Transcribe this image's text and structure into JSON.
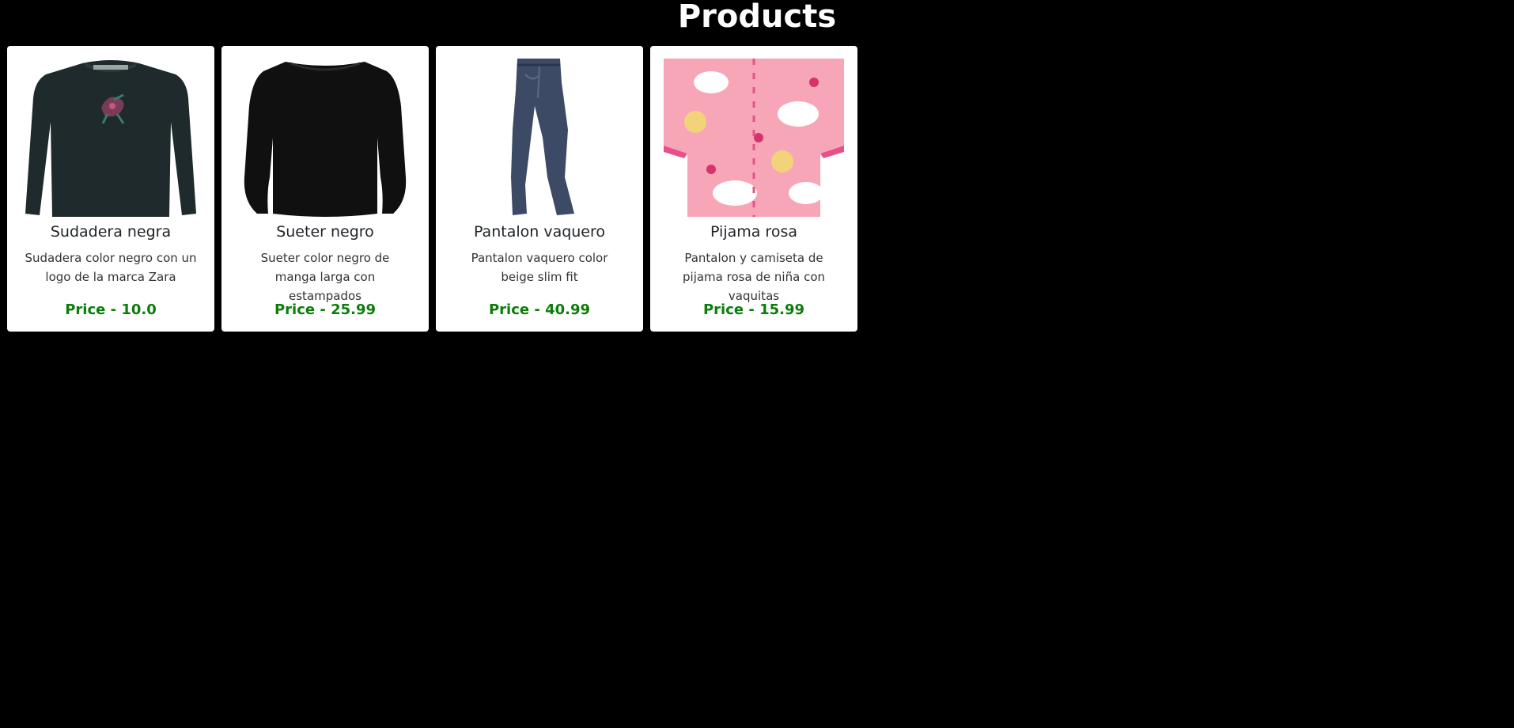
{
  "header": {
    "title": "Products"
  },
  "products": [
    {
      "name": "Sudadera negra",
      "description": "Sudadera color negro con un logo de la marca Zara",
      "price_label": "Price - 10.0",
      "image_icon": "sweatshirt-icon"
    },
    {
      "name": "Sueter negro",
      "description": "Sueter color negro de manga larga con estampados",
      "price_label": "Price - 25.99",
      "image_icon": "sweater-icon"
    },
    {
      "name": "Pantalon vaquero",
      "description": "Pantalon vaquero color beige slim fit",
      "price_label": "Price - 40.99",
      "image_icon": "jeans-icon"
    },
    {
      "name": "Pijama rosa",
      "description": "Pantalon y camiseta de pijama rosa de niña con vaquitas",
      "price_label": "Price - 15.99",
      "image_icon": "pajama-icon"
    }
  ],
  "colors": {
    "background": "#000000",
    "card": "#ffffff",
    "price": "#0a7d0a",
    "sweatshirt": "#1e2a2c",
    "sweater": "#101010",
    "jeans": "#3c4a66",
    "pajama": "#f7a6b8"
  }
}
